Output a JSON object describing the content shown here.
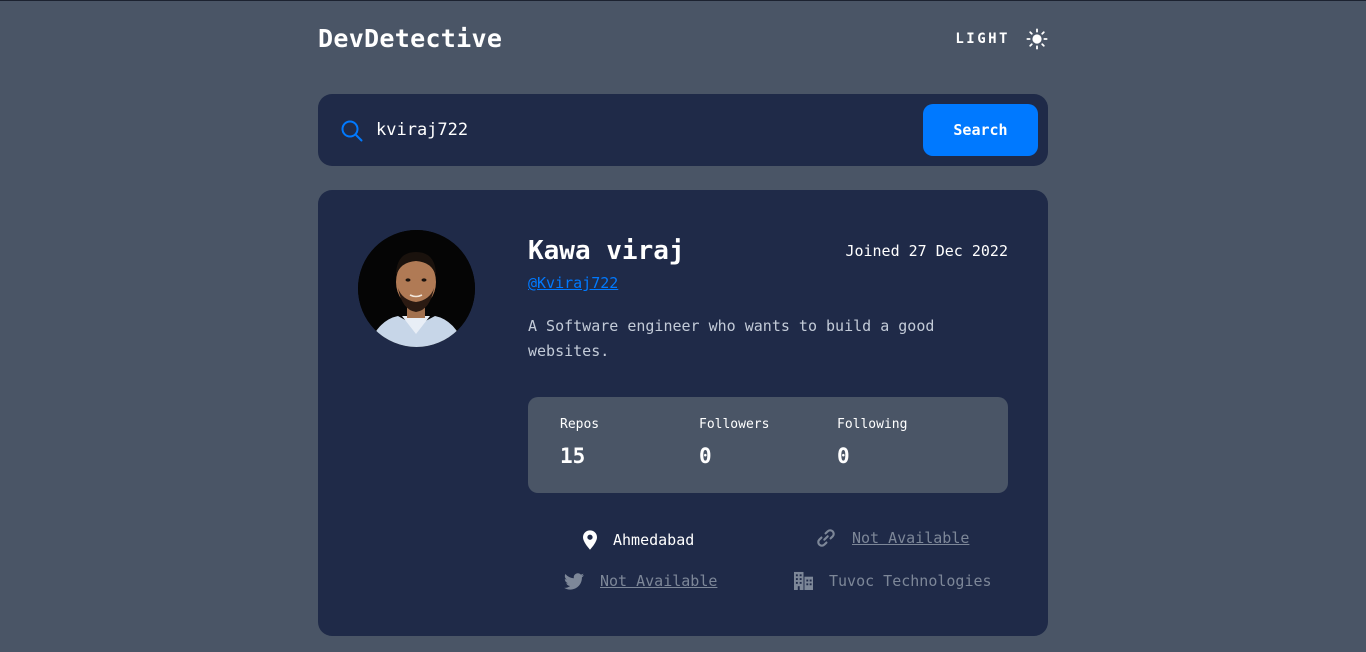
{
  "header": {
    "brand": "DevDetective",
    "theme_label": "LIGHT",
    "theme_icon": "sun-icon"
  },
  "search": {
    "icon": "search-icon",
    "value": "kviraj722",
    "placeholder": "",
    "button_label": "Search"
  },
  "profile": {
    "name": "Kawa viraj",
    "joined": "Joined 27 Dec 2022",
    "handle": "@Kviraj722",
    "bio": "A Software engineer who wants to build a good websites.",
    "stats": [
      {
        "label": "Repos",
        "value": "15"
      },
      {
        "label": "Followers",
        "value": "0"
      },
      {
        "label": "Following",
        "value": "0"
      }
    ],
    "links": {
      "location": {
        "icon": "location-pin-icon",
        "text": "Ahmedabad"
      },
      "website": {
        "icon": "link-icon",
        "text": "Not Available"
      },
      "twitter": {
        "icon": "twitter-icon",
        "text": "Not Available"
      },
      "company": {
        "icon": "building-icon",
        "text": "Tuvoc Technologies"
      }
    }
  },
  "colors": {
    "page_bg": "#4a5566",
    "card_bg": "#1f2a48",
    "accent": "#0079ff",
    "muted": "#7d8798"
  }
}
